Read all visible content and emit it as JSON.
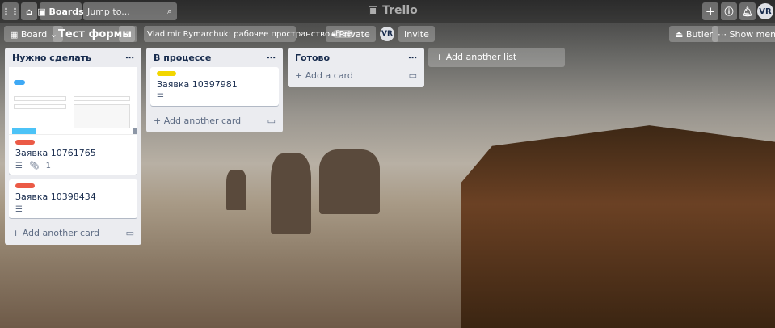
{
  "header": {
    "boards_label": "Boards",
    "search_placeholder": "Jump to...",
    "logo": "Trello",
    "avatar": "VR"
  },
  "board_bar": {
    "view_label": "Board",
    "title": "Тест формы",
    "workspace": "Vladimir Rymarchuk: рабочее пространство",
    "plan_badge": "Free",
    "visibility": "Private",
    "member_avatar": "VR",
    "invite": "Invite",
    "butler": "Butler",
    "show_menu": "Show menu"
  },
  "lists": [
    {
      "title": "Нужно сделать",
      "add_label": "Add another card",
      "cards": [
        {
          "title": "Заявка 10761765",
          "label_color": "#eb5a46",
          "has_cover": true,
          "attachments": "1"
        },
        {
          "title": "Заявка 10398434",
          "label_color": "#eb5a46"
        }
      ]
    },
    {
      "title": "В процессе",
      "add_label": "Add another card",
      "cards": [
        {
          "title": "Заявка 10397981",
          "label_color": "#f2d600"
        }
      ]
    },
    {
      "title": "Готово",
      "add_label": "Add a card",
      "cards": []
    }
  ],
  "add_list_label": "Add another list"
}
